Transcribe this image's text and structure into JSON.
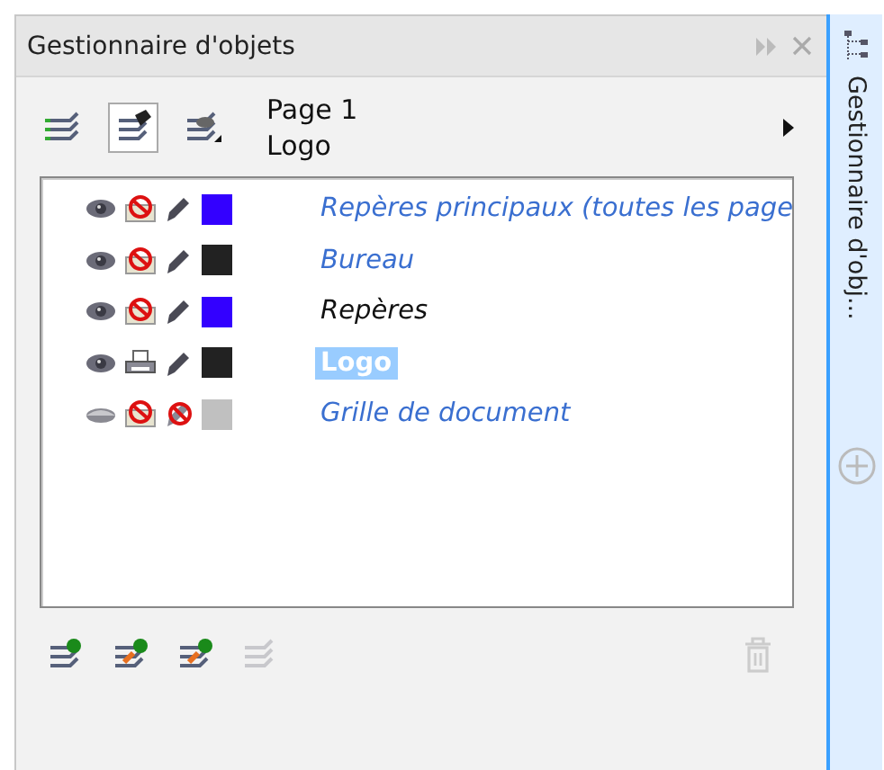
{
  "panel": {
    "title": "Gestionnaire d'objets"
  },
  "view_buttons": [
    {
      "selected": false
    },
    {
      "selected": true
    },
    {
      "selected": false
    }
  ],
  "page": {
    "name": "Page 1",
    "layer": "Logo"
  },
  "layers": [
    {
      "name": "Repères principaux (toutes les page",
      "kind": "master",
      "visible": true,
      "printable": false,
      "editable": true,
      "color": "#3300ff",
      "selected": false
    },
    {
      "name": "Bureau",
      "kind": "master",
      "visible": true,
      "printable": false,
      "editable": true,
      "color": "#222222",
      "selected": false
    },
    {
      "name": "Repères",
      "kind": "guides",
      "visible": true,
      "printable": false,
      "editable": true,
      "color": "#3300ff",
      "selected": false
    },
    {
      "name": "Logo",
      "kind": "layer",
      "visible": true,
      "printable": true,
      "editable": true,
      "color": "#222222",
      "selected": true
    },
    {
      "name": "Grille de document",
      "kind": "master",
      "visible": false,
      "printable": false,
      "editable": false,
      "color": "#c0c0c0",
      "selected": false
    }
  ],
  "bottom_buttons": [
    {
      "disabled": false
    },
    {
      "disabled": false
    },
    {
      "disabled": false
    },
    {
      "disabled": true
    }
  ],
  "delete_button": {
    "disabled": true
  },
  "side_tab": {
    "label": "Gestionnaire d'obj...",
    "selected": true
  }
}
